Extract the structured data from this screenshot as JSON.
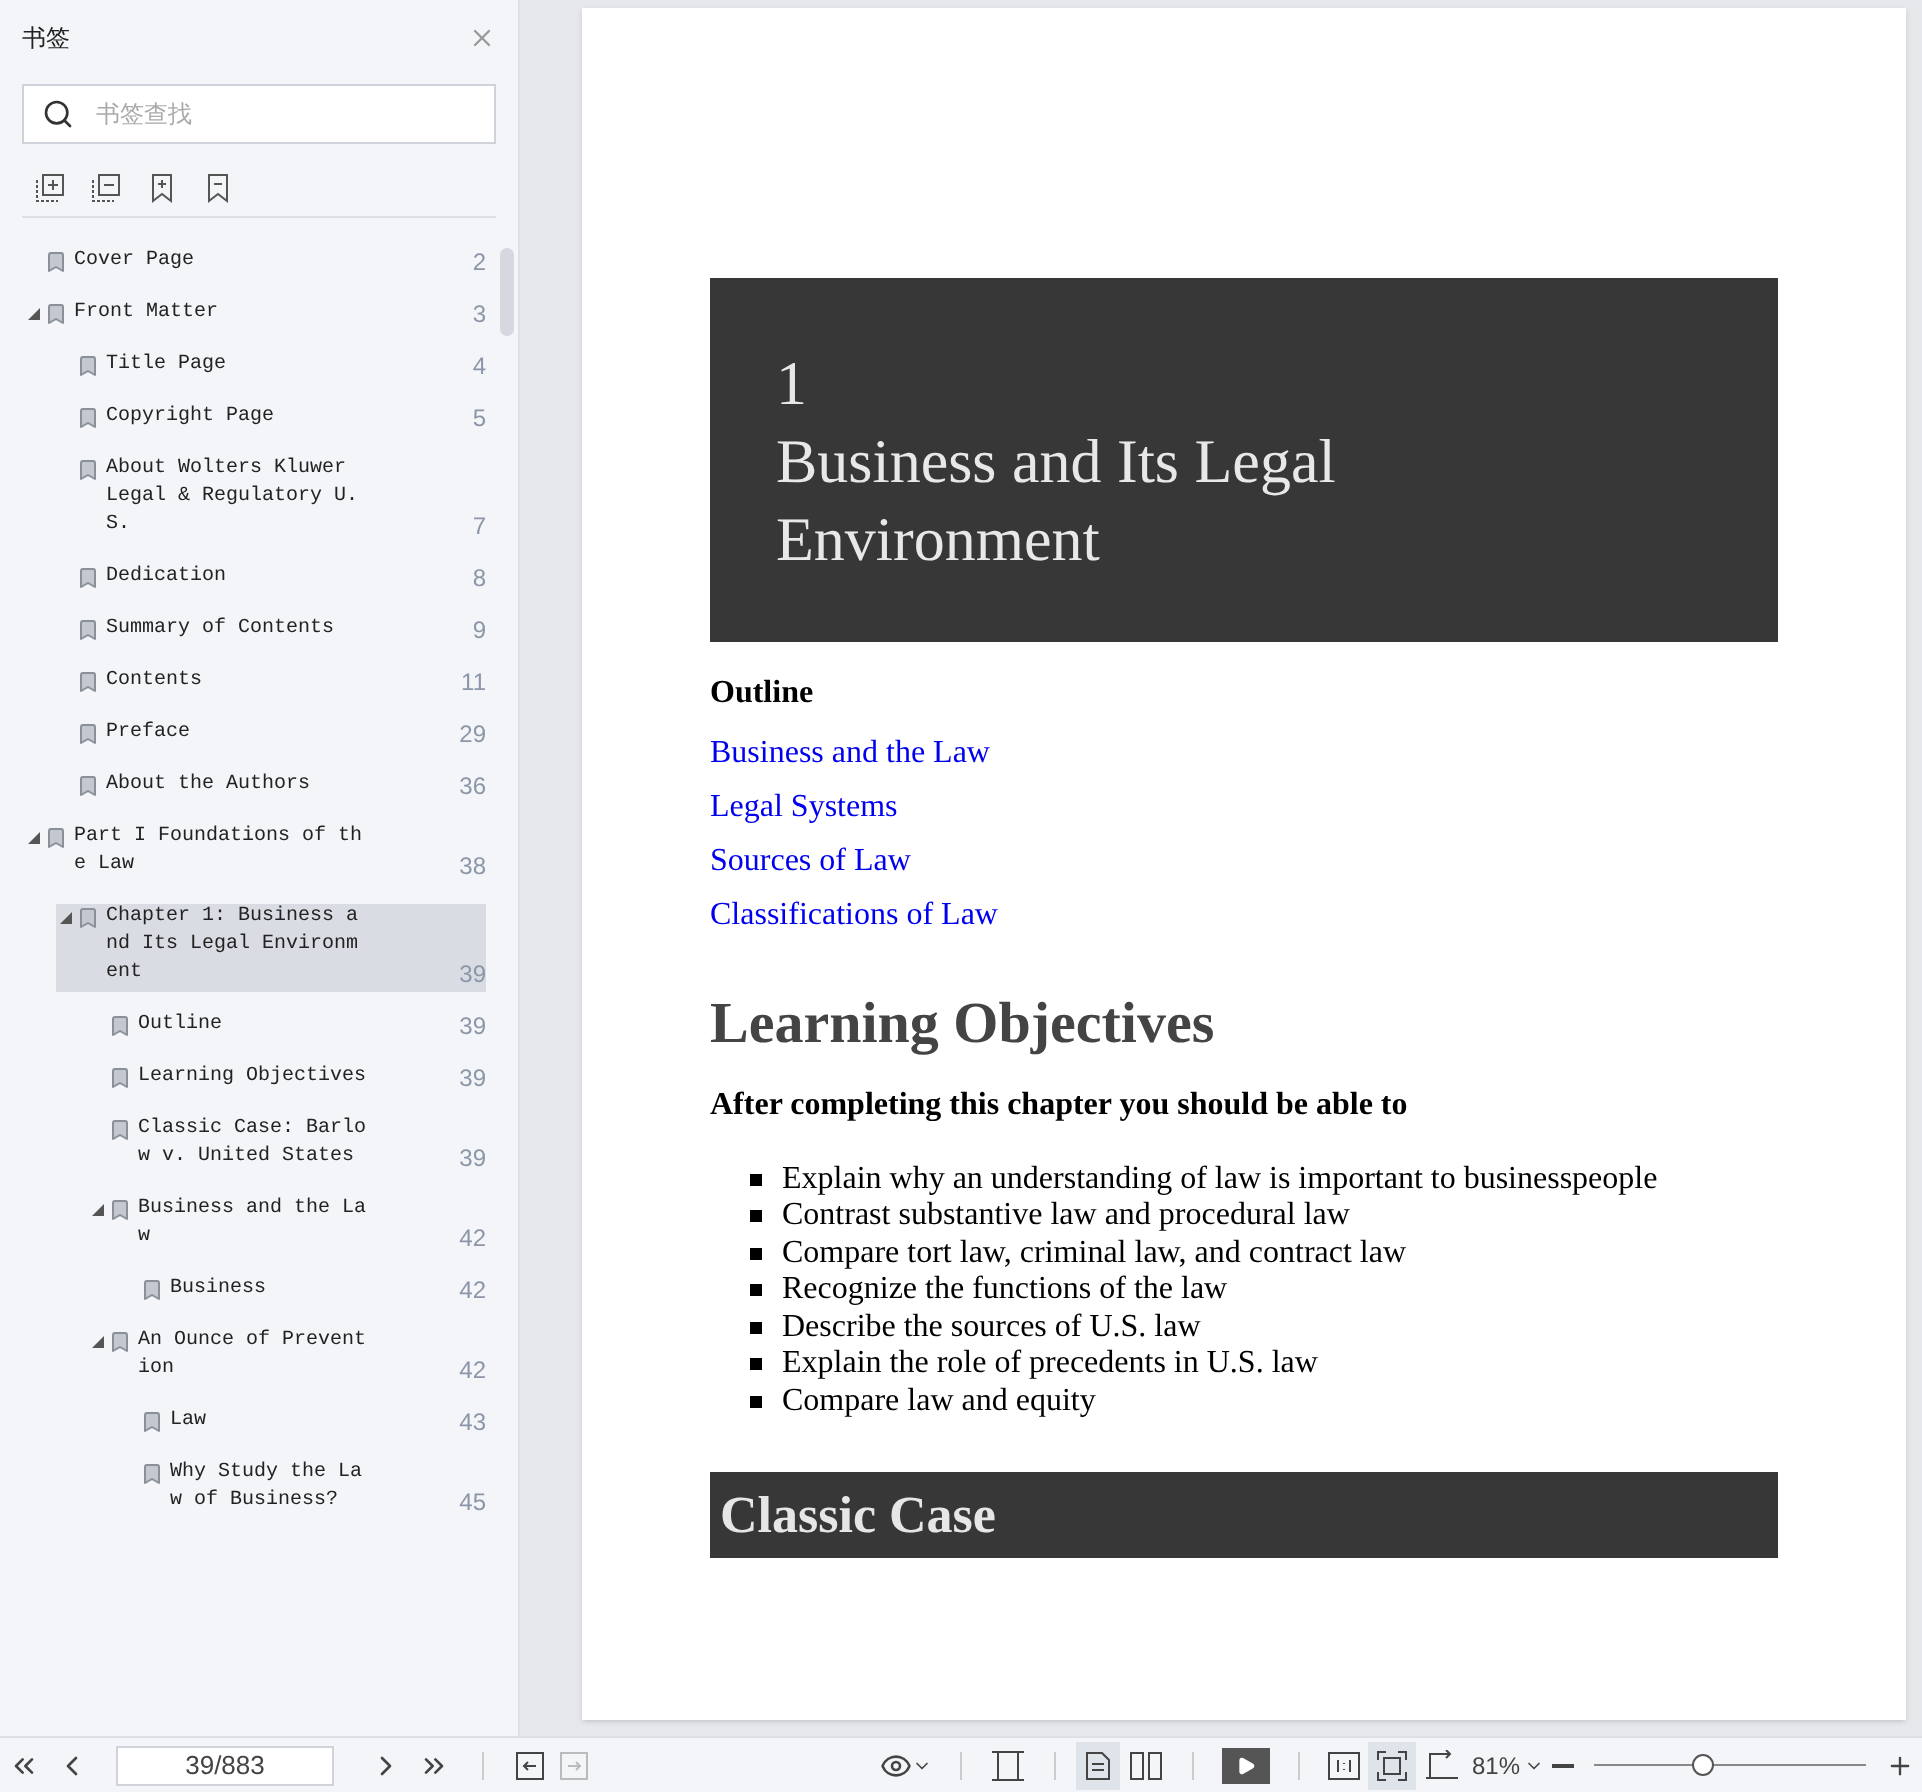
{
  "sidebar": {
    "title": "书签",
    "search": {
      "placeholder": "书签查找"
    },
    "bookmarks": [
      {
        "label": "Cover Page",
        "page": "2",
        "selected": false
      },
      {
        "label": "Front Matter",
        "page": "3",
        "selected": false,
        "expanded": true,
        "children": [
          {
            "label": "Title Page",
            "page": "4",
            "selected": false
          },
          {
            "label": "Copyright Page",
            "page": "5",
            "selected": false
          },
          {
            "label": "About Wolters Kluwer Legal & Regulatory U.S.",
            "page": "7",
            "selected": false
          },
          {
            "label": "Dedication",
            "page": "8",
            "selected": false
          },
          {
            "label": "Summary of Contents",
            "page": "9",
            "selected": false
          },
          {
            "label": "Contents",
            "page": "11",
            "selected": false
          },
          {
            "label": "Preface",
            "page": "29",
            "selected": false
          },
          {
            "label": "About the Authors",
            "page": "36",
            "selected": false
          }
        ]
      },
      {
        "label": "Part I Foundations of the Law",
        "page": "38",
        "selected": false,
        "expanded": true,
        "children": [
          {
            "label": "Chapter 1: Business and Its Legal Environment",
            "page": "39",
            "selected": true,
            "expanded": true,
            "children": [
              {
                "label": "Outline",
                "page": "39",
                "selected": false
              },
              {
                "label": "Learning Objectives",
                "page": "39",
                "selected": false
              },
              {
                "label": "Classic Case: Barlow v. United States",
                "page": "39",
                "selected": false
              },
              {
                "label": "Business and the Law",
                "page": "42",
                "selected": false,
                "expanded": true,
                "children": [
                  {
                    "label": "Business",
                    "page": "42",
                    "selected": false
                  }
                ]
              },
              {
                "label": "An Ounce of Prevention",
                "page": "42",
                "selected": false,
                "expanded": true,
                "children": [
                  {
                    "label": "Law",
                    "page": "43",
                    "selected": false
                  },
                  {
                    "label": "Why Study the Law of Business?",
                    "page": "45",
                    "selected": false
                  }
                ]
              }
            ]
          }
        ]
      }
    ]
  },
  "document": {
    "chapter_number": "1",
    "chapter_title": "Business and Its Legal Environment",
    "outline_heading": "Outline",
    "outline_links": [
      "Business and the Law",
      "Legal Systems",
      "Sources of Law",
      "Classifications of Law"
    ],
    "objectives_heading": "Learning Objectives",
    "objectives_intro": "After completing this chapter you should be able to",
    "objectives": [
      "Explain why an understanding of law is important to businesspeople",
      "Contrast substantive law and procedural law",
      "Compare tort law, criminal law, and contract law",
      "Recognize the functions of the law",
      "Describe the sources of U.S. law",
      "Explain the role of precedents in U.S. law",
      "Compare law and equity"
    ],
    "case_heading": "Classic Case"
  },
  "toolbar": {
    "page_field": "39/883",
    "zoom": "81%",
    "zoom_slider": {
      "level": 0.4
    },
    "single_page_selected": true,
    "fit_selected": true
  }
}
